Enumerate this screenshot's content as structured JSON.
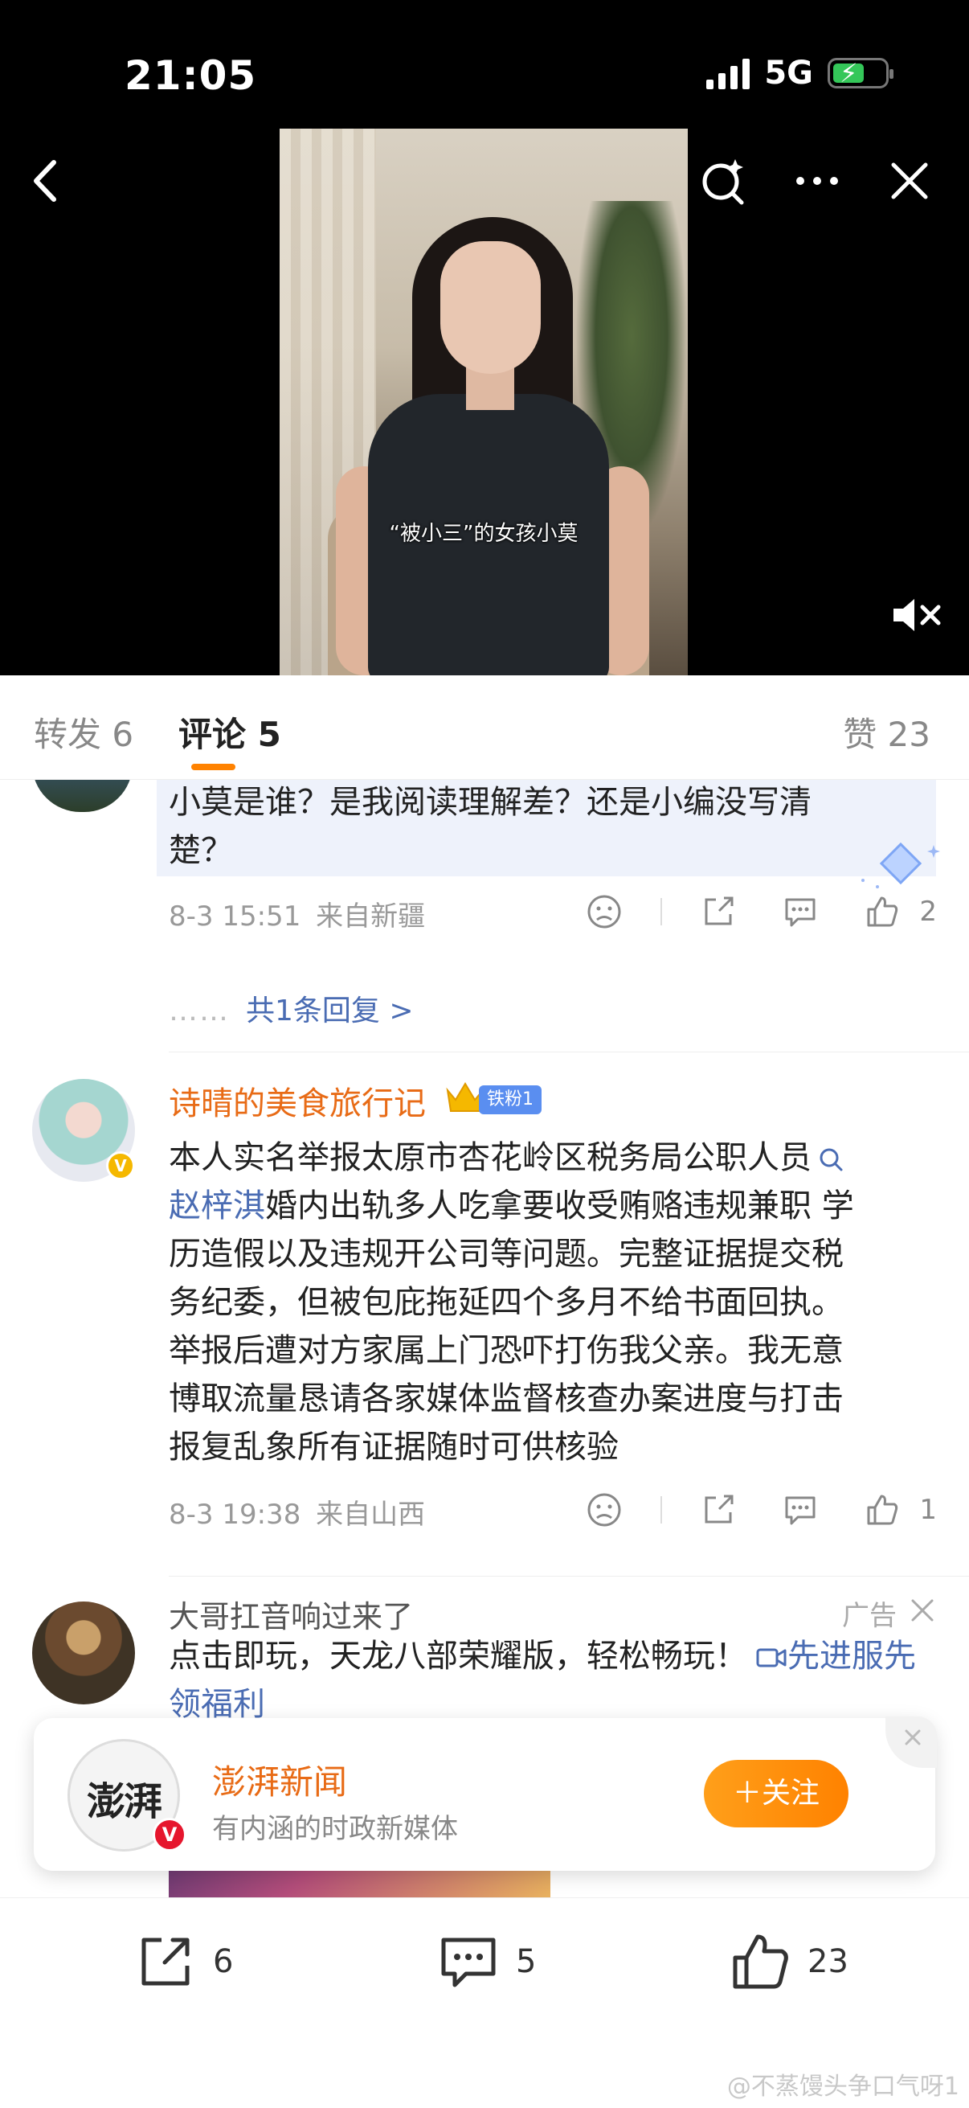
{
  "status_bar": {
    "time": "21:05",
    "network": "5G"
  },
  "video": {
    "caption": "“被小三”的女孩小莫"
  },
  "tabs": {
    "repost": "转发 6",
    "comment": "评论 5",
    "like": "赞 23"
  },
  "comments": [
    {
      "text_line1": "小莫是谁？是我阅读理解差？还是小编没写清",
      "text_line2": "楚？",
      "time": "8-3 15:51",
      "location": "来自新疆",
      "likes": "2",
      "replies": "共1条回复 >",
      "reply_dots": "……"
    },
    {
      "username": "诗晴的美食旅行记",
      "fan_badge": "铁粉1",
      "line1": "本人实名举报太原市杏花岭区税务局公职人员",
      "line2_link": "赵梓淇",
      "line2_rest": "婚内出轨多人吃拿要收受贿赂违规兼职 学",
      "line3": "历造假以及违规开公司等问题。完整证据提交税",
      "line4": "务纪委，但被包庇拖延四个多月不给书面回执。",
      "line5": "举报后遭对方家属上门恐吓打伤我父亲。我无意",
      "line6": "博取流量恳请各家媒体监督核查办案进度与打击",
      "line7": "报复乱象所有证据随时可供核验",
      "time": "8-3 19:38",
      "location": "来自山西",
      "likes": "1"
    }
  ],
  "ad": {
    "username": "大哥扛音响过来了",
    "label": "广告",
    "text": "点击即玩，天龙八部荣耀版，轻松畅玩！",
    "link": "先进服先领福利"
  },
  "card": {
    "logo_text": "澎湃",
    "title": "澎湃新闻",
    "subtitle": "有内涵的时政新媒体",
    "follow": "＋关注"
  },
  "bottom_bar": {
    "shares": "6",
    "comments": "5",
    "likes": "23"
  },
  "watermark": "@不蒸馒头争口气呀1",
  "colors": {
    "accent": "#ff8200",
    "link": "#4a6cb3",
    "username": "#e86b16"
  }
}
